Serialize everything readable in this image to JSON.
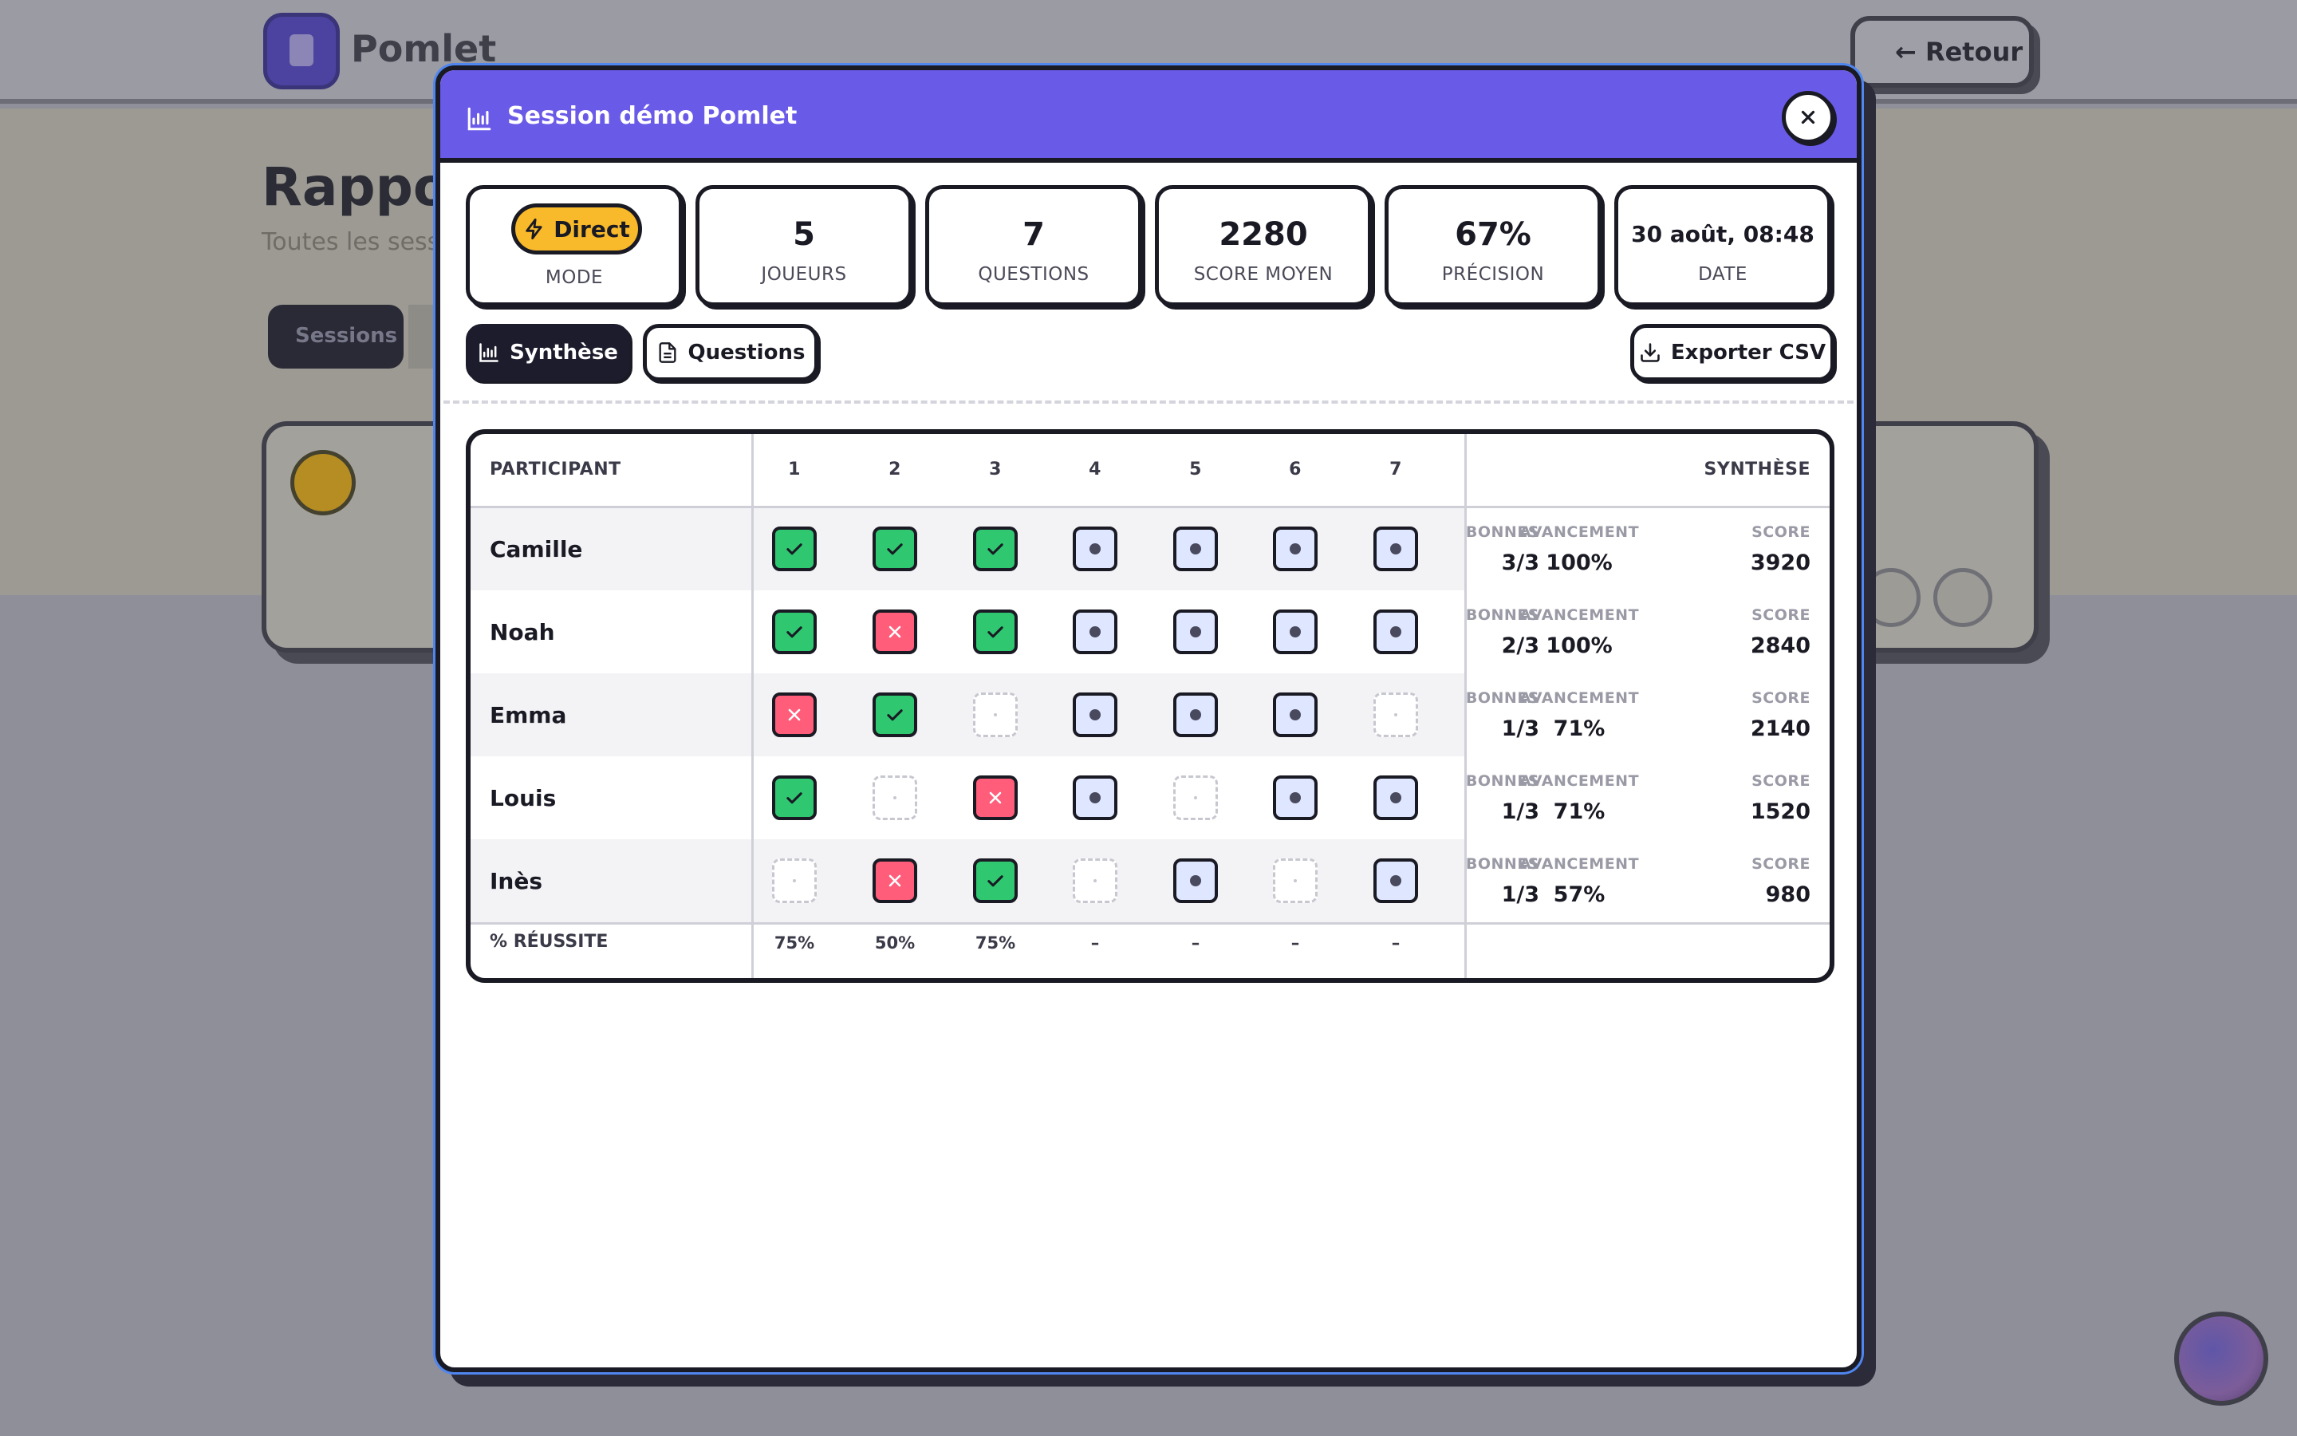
{
  "background": {
    "brand": "Pomlet",
    "back_label": "Retour",
    "page_title": "Rapports",
    "page_subtitle": "Toutes les sessions",
    "tab_label": "Sessions"
  },
  "modal": {
    "title": "Session démo Pomlet",
    "accent_color": "#6a5ae8"
  },
  "stats": {
    "mode": {
      "value": "Direct",
      "label": "MODE"
    },
    "players": {
      "value": "5",
      "label": "JOUEURS"
    },
    "questions": {
      "value": "7",
      "label": "QUESTIONS"
    },
    "avg_score": {
      "value": "2280",
      "label": "SCORE MOYEN"
    },
    "precision": {
      "value": "67%",
      "label": "PRÉCISION"
    },
    "date": {
      "value": "30 août, 08:48",
      "label": "DATE"
    }
  },
  "toolbar": {
    "tabs": [
      {
        "label": "Synthèse",
        "icon": "bar-chart-icon",
        "active": true
      },
      {
        "label": "Questions",
        "icon": "document-icon",
        "active": false
      }
    ],
    "export_label": "Exporter CSV"
  },
  "table": {
    "header_participant": "PARTICIPANT",
    "header_summary": "SYNTHÈSE",
    "question_numbers": [
      "1",
      "2",
      "3",
      "4",
      "5",
      "6",
      "7"
    ],
    "summary_labels": {
      "correct": "BONNES",
      "progress": "AVANCEMENT",
      "score": "SCORE"
    },
    "rows": [
      {
        "name": "Camille",
        "answers": [
          "correct",
          "correct",
          "correct",
          "pending",
          "pending",
          "pending",
          "pending"
        ],
        "correct": "3/3",
        "progress": "100%",
        "score": "3920"
      },
      {
        "name": "Noah",
        "answers": [
          "correct",
          "wrong",
          "correct",
          "pending",
          "pending",
          "pending",
          "pending"
        ],
        "correct": "2/3",
        "progress": "100%",
        "score": "2840"
      },
      {
        "name": "Emma",
        "answers": [
          "wrong",
          "correct",
          "empty",
          "pending",
          "pending",
          "pending",
          "empty"
        ],
        "correct": "1/3",
        "progress": "71%",
        "score": "2140"
      },
      {
        "name": "Louis",
        "answers": [
          "correct",
          "empty",
          "wrong",
          "pending",
          "empty",
          "pending",
          "pending"
        ],
        "correct": "1/3",
        "progress": "71%",
        "score": "1520"
      },
      {
        "name": "Inès",
        "answers": [
          "empty",
          "wrong",
          "correct",
          "empty",
          "pending",
          "empty",
          "pending"
        ],
        "correct": "1/3",
        "progress": "57%",
        "score": "980"
      }
    ],
    "footer_label": "% RÉUSSITE",
    "success_rates": [
      "75%",
      "50%",
      "75%",
      "–",
      "–",
      "–",
      "–"
    ]
  },
  "colors": {
    "correct": "#2fc870",
    "wrong": "#ff5d7a",
    "pending": "#dfe6ff",
    "mode_pill": "#f8b92a"
  }
}
